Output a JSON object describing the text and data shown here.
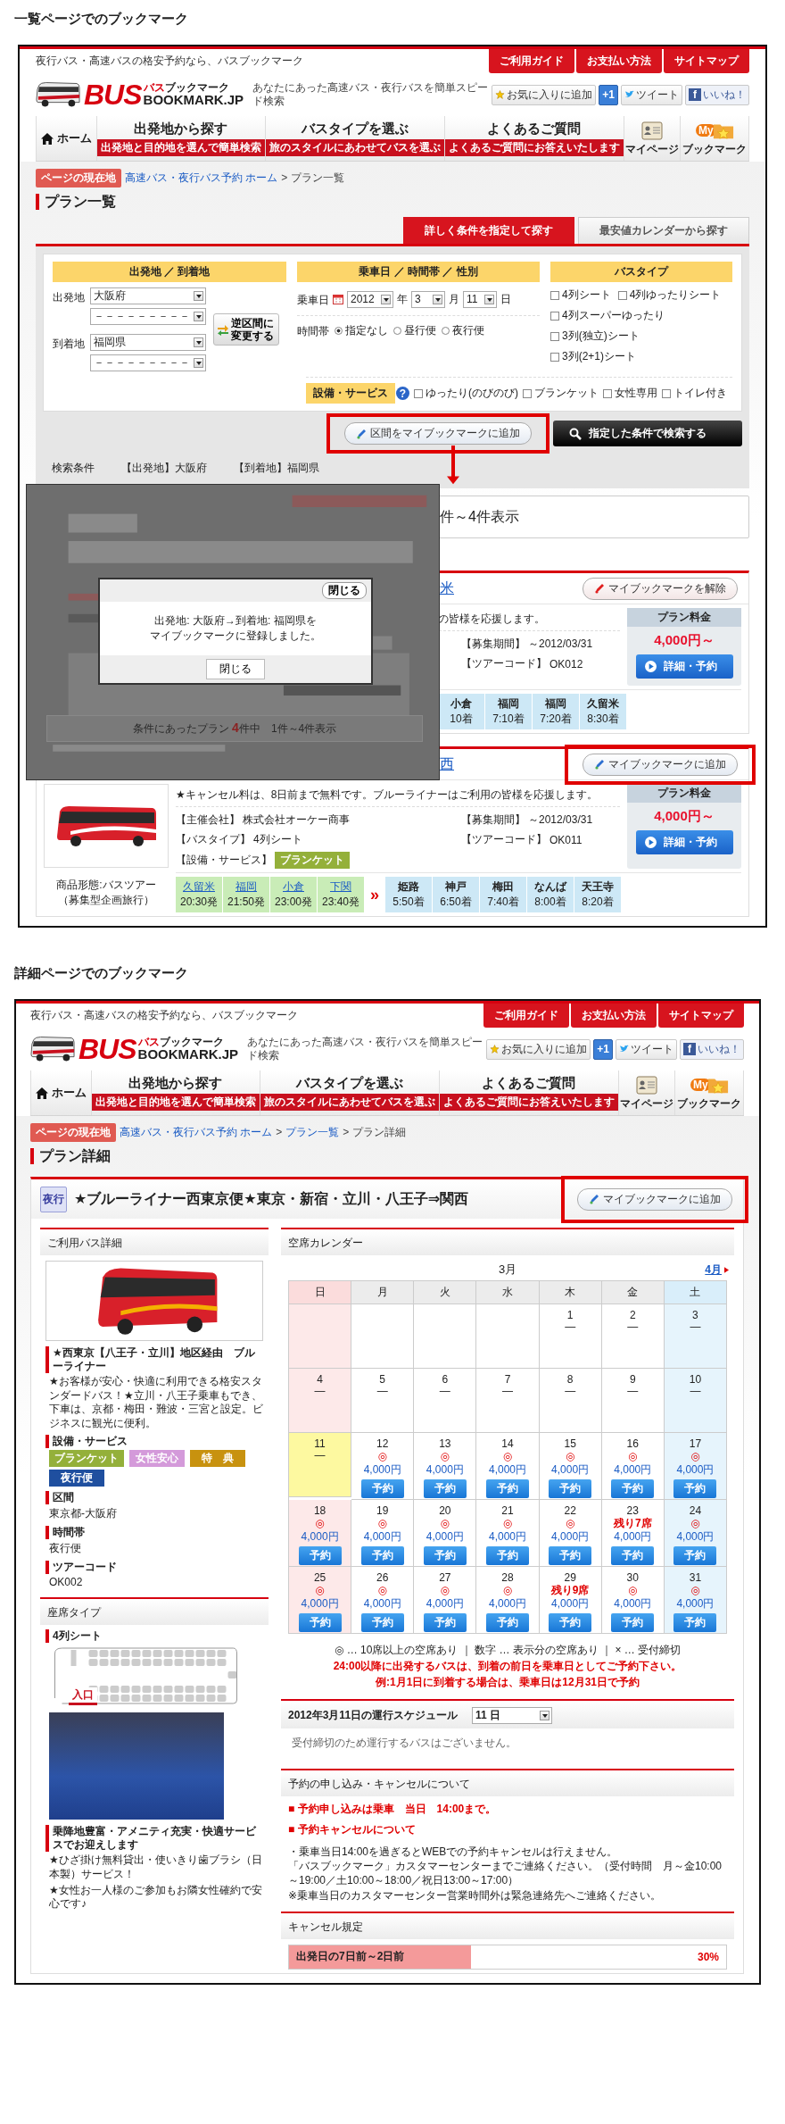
{
  "pages": [
    {
      "kind": "list",
      "caption": "一覧ページでのブックマーク",
      "header": {
        "tagline": "夜行バス・高速バスの格安予約なら、バスブックマーク",
        "top_links": [
          "ご利用ガイド",
          "お支払い方法",
          "サイトマップ"
        ],
        "logo": {
          "brand": "BUS",
          "kana_red": "バス",
          "kana": "ブックマーク",
          "domain": "BOOKMARK.JP"
        },
        "catchphrase": "あなたにあった高速バス・夜行バスを簡単スピード検索",
        "social": [
          {
            "kind": "favorite",
            "label": "お気に入りに追加"
          },
          {
            "kind": "plusone",
            "label": "+1"
          },
          {
            "kind": "tweet",
            "label": "ツイート"
          },
          {
            "kind": "like",
            "icon_text": "f",
            "label": "いいね！"
          }
        ],
        "nav": [
          {
            "kind": "home",
            "label": "ホーム"
          },
          {
            "kind": "menu",
            "label": "出発地から探す",
            "sub": "出発地と目的地を選んで簡単検索"
          },
          {
            "kind": "menu",
            "label": "バスタイプを選ぶ",
            "sub": "旅のスタイルにあわせてバスを選ぶ"
          },
          {
            "kind": "menu",
            "label": "よくあるご質問",
            "sub": "よくあるご質問にお答えいたします"
          },
          {
            "kind": "mypage",
            "label": "マイページ"
          },
          {
            "kind": "bookmark",
            "label": "ブックマーク",
            "badge": "My"
          }
        ]
      },
      "breadcrumb": {
        "label": "ページの現在地",
        "separator": ">",
        "items": [
          {
            "text": "高速バス・夜行バス予約 ホーム",
            "kind": "link"
          },
          {
            "text": "プラン一覧",
            "kind": "current"
          }
        ]
      },
      "page_title": "プラン一覧",
      "search": {
        "tabs": [
          {
            "label": "詳しく条件を指定して探す",
            "selected": true
          },
          {
            "label": "最安値カレンダーから探す",
            "selected": false
          }
        ],
        "route": {
          "heading": "出発地 ／ 到着地",
          "departure_label": "出発地",
          "departure": [
            "大阪府",
            "－－－－－－－－－"
          ],
          "arrival_label": "到着地",
          "arrival": [
            "福岡県",
            "－－－－－－－－－"
          ],
          "swap_button": "逆区間に変更する"
        },
        "date": {
          "heading": "乗車日 ／ 時間帯 ／ 性別",
          "label": "乗車日",
          "year": "2012",
          "year_unit": "年",
          "month": "3",
          "month_unit": "月",
          "day": "11",
          "day_unit": "日",
          "time_label": "時間帯",
          "times": [
            {
              "label": "指定なし",
              "selected": true
            },
            {
              "label": "昼行便",
              "selected": false
            },
            {
              "label": "夜行便",
              "selected": false
            }
          ]
        },
        "bus_type": {
          "heading": "バスタイプ",
          "options": [
            {
              "label": "4列シート",
              "checked": false
            },
            {
              "label": "4列ゆったりシート",
              "checked": false
            },
            {
              "label": "4列スーパーゆったり",
              "checked": false
            },
            {
              "label": "3列(独立)シート",
              "checked": false
            },
            {
              "label": "3列(2+1)シート",
              "checked": false
            }
          ]
        },
        "services": {
          "heading": "設備・サービス",
          "help": "?",
          "options": [
            {
              "label": "ゆったり(のびのび)",
              "checked": false
            },
            {
              "label": "ブランケット",
              "checked": false
            },
            {
              "label": "女性専用",
              "checked": false
            },
            {
              "label": "トイレ付き",
              "checked": false
            }
          ]
        },
        "bookmark_button": {
          "label": "区間をマイブックマークに追加",
          "highlighted": true
        },
        "search_button": "指定した条件で検索する",
        "conditions": {
          "label": "検索条件",
          "items": [
            "【出発地】大阪府",
            "【到着地】福岡県"
          ]
        }
      },
      "results": {
        "summary": "件～4件表示"
      },
      "overlay": {
        "close_top": "閉じる",
        "message_lines": [
          "出発地: 大阪府→到着地: 福岡県を",
          "マイブックマークに登録しました。"
        ],
        "close_bottom": "閉じる",
        "summary_before": "条件にあったプラン",
        "count": "4",
        "count_unit": "件中",
        "summary_after": "1件～4件表示"
      },
      "plans": [
        {
          "title": "米",
          "bookmark": {
            "label": "マイブックマークを解除",
            "on": true,
            "highlighted": false
          },
          "lead": "の皆様を応援します。",
          "info_right": [
            {
              "label": "【募集期間】",
              "value": "～2012/03/31"
            },
            {
              "label": "【ツアーコード】",
              "value": "OK012"
            }
          ],
          "price_label": "プラン料金",
          "price": "4,000円～",
          "detail_button": "詳細・予約",
          "arrivals": [
            {
              "place": "小倉",
              "time": "10着"
            },
            {
              "place": "福岡",
              "time": "7:10着"
            },
            {
              "place": "福岡",
              "time": "7:20着"
            },
            {
              "place": "久留米",
              "time": "8:30着"
            }
          ]
        },
        {
          "title": "西",
          "bookmark": {
            "label": "マイブックマークに追加",
            "on": false,
            "highlighted": true
          },
          "lead": "★キャンセル料は、8日前まで無料です。ブルーライナーはご利用の皆様を応援します。",
          "info_left": [
            {
              "label": "【主催会社】",
              "value": "株式会社オーケー商事"
            },
            {
              "label": "【バスタイプ】",
              "value": "4列シート"
            },
            {
              "label": "【設備・サービス】",
              "tag": "ブランケット"
            }
          ],
          "info_right": [
            {
              "label": "【募集期間】",
              "value": "～2012/03/31"
            },
            {
              "label": "【ツアーコード】",
              "value": "OK011"
            }
          ],
          "price_label": "プラン料金",
          "price": "4,000円～",
          "detail_button": "詳細・予約",
          "product": [
            "商品形態:バスツアー",
            "（募集型企画旅行）"
          ],
          "arrow": "»",
          "departures": [
            {
              "place": "久留米",
              "time": "20:30発"
            },
            {
              "place": "福岡",
              "time": "21:50発"
            },
            {
              "place": "小倉",
              "time": "23:00発"
            },
            {
              "place": "下関",
              "time": "23:40発"
            }
          ],
          "arrivals": [
            {
              "place": "姫路",
              "time": "5:50着"
            },
            {
              "place": "神戸",
              "time": "6:50着"
            },
            {
              "place": "梅田",
              "time": "7:40着"
            },
            {
              "place": "なんば",
              "time": "8:00着"
            },
            {
              "place": "天王寺",
              "time": "8:20着"
            }
          ]
        }
      ]
    },
    {
      "kind": "detail",
      "caption": "詳細ページでのブックマーク",
      "header": {
        "tagline": "夜行バス・高速バスの格安予約なら、バスブックマーク",
        "top_links": [
          "ご利用ガイド",
          "お支払い方法",
          "サイトマップ"
        ],
        "logo": {
          "brand": "BUS",
          "kana_red": "バス",
          "kana": "ブックマーク",
          "domain": "BOOKMARK.JP"
        },
        "catchphrase": "あなたにあった高速バス・夜行バスを簡単スピード検索",
        "social": [
          {
            "kind": "favorite",
            "label": "お気に入りに追加"
          },
          {
            "kind": "plusone",
            "label": "+1"
          },
          {
            "kind": "tweet",
            "label": "ツイート"
          },
          {
            "kind": "like",
            "icon_text": "f",
            "label": "いいね！"
          }
        ],
        "nav": [
          {
            "kind": "home",
            "label": "ホーム"
          },
          {
            "kind": "menu",
            "label": "出発地から探す",
            "sub": "出発地と目的地を選んで簡単検索"
          },
          {
            "kind": "menu",
            "label": "バスタイプを選ぶ",
            "sub": "旅のスタイルにあわせてバスを選ぶ"
          },
          {
            "kind": "menu",
            "label": "よくあるご質問",
            "sub": "よくあるご質問にお答えいたします"
          },
          {
            "kind": "mypage",
            "label": "マイページ"
          },
          {
            "kind": "bookmark",
            "label": "ブックマーク",
            "badge": "My"
          }
        ]
      },
      "breadcrumb": {
        "label": "ページの現在地",
        "separator": ">",
        "items": [
          {
            "text": "高速バス・夜行バス予約 ホーム",
            "kind": "link"
          },
          {
            "text": "プラン一覧",
            "kind": "link"
          },
          {
            "text": "プラン詳細",
            "kind": "current"
          }
        ]
      },
      "page_title": "プラン詳細",
      "plan": {
        "badge": "夜行",
        "title": "★ブルーライナー西東京便★東京・新宿・立川・八王子⇒関西",
        "bookmark": {
          "label": "マイブックマークに追加",
          "on": false,
          "highlighted": true
        },
        "bus": {
          "heading": "ご利用バス詳細",
          "name": "★西東京【八王子・立川】地区経由　ブルーライナー",
          "description": "★お客様が安心・快適に利用できる格安スタンダードバス！★立川・八王子乗車もでき、下車は、京都・梅田・難波・三宮と設定。ビジネスに観光に便利。",
          "facts": [
            {
              "kind": "tags",
              "label": "設備・サービス",
              "tags": [
                {
                  "text": "ブランケット",
                  "color": "#94b03a"
                },
                {
                  "text": "女性安心",
                  "color": "#d49ada"
                },
                {
                  "text": "特　典",
                  "color": "#c8920f"
                },
                {
                  "text": "夜行便",
                  "color": "#1f4f9f"
                }
              ]
            },
            {
              "kind": "text",
              "label": "区間",
              "value": "東京都-大阪府"
            },
            {
              "kind": "text",
              "label": "時間帯",
              "value": "夜行便"
            },
            {
              "kind": "text",
              "label": "ツアーコード",
              "value": "OK002"
            }
          ]
        },
        "seats": {
          "heading": "座席タイプ",
          "type": "4列シート",
          "entrance": "入口",
          "feature_title": "乗降地豊富・アメニティ充実・快適サービスでお迎えします",
          "features": [
            "★ひざ掛け無料貸出・使いきり歯ブラシ（日本製）サービス！",
            "★女性お一人様のご参加もお隣女性確約で安心です♪"
          ]
        },
        "calendar": {
          "heading": "空席カレンダー",
          "month": "3月",
          "next": "4月",
          "weekdays": [
            "日",
            "月",
            "火",
            "水",
            "木",
            "金",
            "土"
          ],
          "weeks": [
            [
              {
                "kind": "empty"
              },
              {
                "kind": "empty"
              },
              {
                "kind": "empty"
              },
              {
                "kind": "empty"
              },
              {
                "kind": "closed",
                "day": "1",
                "status": "—"
              },
              {
                "kind": "closed",
                "day": "2",
                "status": "—"
              },
              {
                "kind": "closed",
                "day": "3",
                "status": "—"
              }
            ],
            [
              {
                "kind": "closed",
                "day": "4",
                "status": "—"
              },
              {
                "kind": "closed",
                "day": "5",
                "status": "—"
              },
              {
                "kind": "closed",
                "day": "6",
                "status": "—"
              },
              {
                "kind": "closed",
                "day": "7",
                "status": "—"
              },
              {
                "kind": "closed",
                "day": "8",
                "status": "—"
              },
              {
                "kind": "closed",
                "day": "9",
                "status": "—"
              },
              {
                "kind": "closed",
                "day": "10",
                "status": "—"
              }
            ],
            [
              {
                "kind": "today",
                "day": "11",
                "status": "—"
              },
              {
                "kind": "open",
                "day": "12",
                "mark": "◎",
                "price": "4,000円",
                "button": "予約"
              },
              {
                "kind": "open",
                "day": "13",
                "mark": "◎",
                "price": "4,000円",
                "button": "予約"
              },
              {
                "kind": "open",
                "day": "14",
                "mark": "◎",
                "price": "4,000円",
                "button": "予約"
              },
              {
                "kind": "open",
                "day": "15",
                "mark": "◎",
                "price": "4,000円",
                "button": "予約"
              },
              {
                "kind": "open",
                "day": "16",
                "mark": "◎",
                "price": "4,000円",
                "button": "予約"
              },
              {
                "kind": "open",
                "day": "17",
                "mark": "◎",
                "price": "4,000円",
                "button": "予約"
              }
            ],
            [
              {
                "kind": "open",
                "day": "18",
                "mark": "◎",
                "price": "4,000円",
                "button": "予約"
              },
              {
                "kind": "open",
                "day": "19",
                "mark": "◎",
                "price": "4,000円",
                "button": "予約"
              },
              {
                "kind": "open",
                "day": "20",
                "mark": "◎",
                "price": "4,000円",
                "button": "予約"
              },
              {
                "kind": "open",
                "day": "21",
                "mark": "◎",
                "price": "4,000円",
                "button": "予約"
              },
              {
                "kind": "open",
                "day": "22",
                "mark": "◎",
                "price": "4,000円",
                "button": "予約"
              },
              {
                "kind": "open",
                "day": "23",
                "note": "残り7席",
                "price": "4,000円",
                "button": "予約"
              },
              {
                "kind": "open",
                "day": "24",
                "mark": "◎",
                "price": "4,000円",
                "button": "予約"
              }
            ],
            [
              {
                "kind": "open",
                "day": "25",
                "mark": "◎",
                "price": "4,000円",
                "button": "予約"
              },
              {
                "kind": "open",
                "day": "26",
                "mark": "◎",
                "price": "4,000円",
                "button": "予約"
              },
              {
                "kind": "open",
                "day": "27",
                "mark": "◎",
                "price": "4,000円",
                "button": "予約"
              },
              {
                "kind": "open",
                "day": "28",
                "mark": "◎",
                "price": "4,000円",
                "button": "予約"
              },
              {
                "kind": "open",
                "day": "29",
                "note": "残り9席",
                "price": "4,000円",
                "button": "予約"
              },
              {
                "kind": "open",
                "day": "30",
                "mark": "◎",
                "price": "4,000円",
                "button": "予約"
              },
              {
                "kind": "open",
                "day": "31",
                "mark": "◎",
                "price": "4,000円",
                "button": "予約"
              }
            ]
          ],
          "legend": "◎ … 10席以上の空席あり ｜ 数字 … 表示分の空席あり ｜ × … 受付締切",
          "notes": [
            "24:00以降に出発するバスは、到着の前日を乗車日としてご予約下さい。",
            "例:1月1日に到着する場合は、乗車日は12月31日で予約"
          ]
        },
        "schedule": {
          "title": "2012年3月11日の運行スケジュール",
          "select": "11 日",
          "message": "受付締切のため運行するバスはございません。"
        },
        "cancel": {
          "heading": "予約の申し込み・キャンセルについて",
          "alerts": [
            "■ 予約申し込みは乗車　当日　14:00まで。",
            "■ 予約キャンセルについて"
          ],
          "paragraphs": [
            "・乗車当日14:00を過ぎるとWEBでの予約キャンセルは行えません。",
            "「バスブックマーク」カスタマーセンターまでご連絡ください。（受付時間　月～金10:00～19:00／土10:00～18:00／祝日13:00～17:00）",
            "※乗車当日のカスタマーセンター営業時間外は緊急連絡先へご連絡ください。"
          ],
          "rules_heading": "キャンセル規定",
          "rules": [
            {
              "period": "出発日の7日前～2日前",
              "rate": "30%"
            }
          ]
        }
      }
    }
  ]
}
